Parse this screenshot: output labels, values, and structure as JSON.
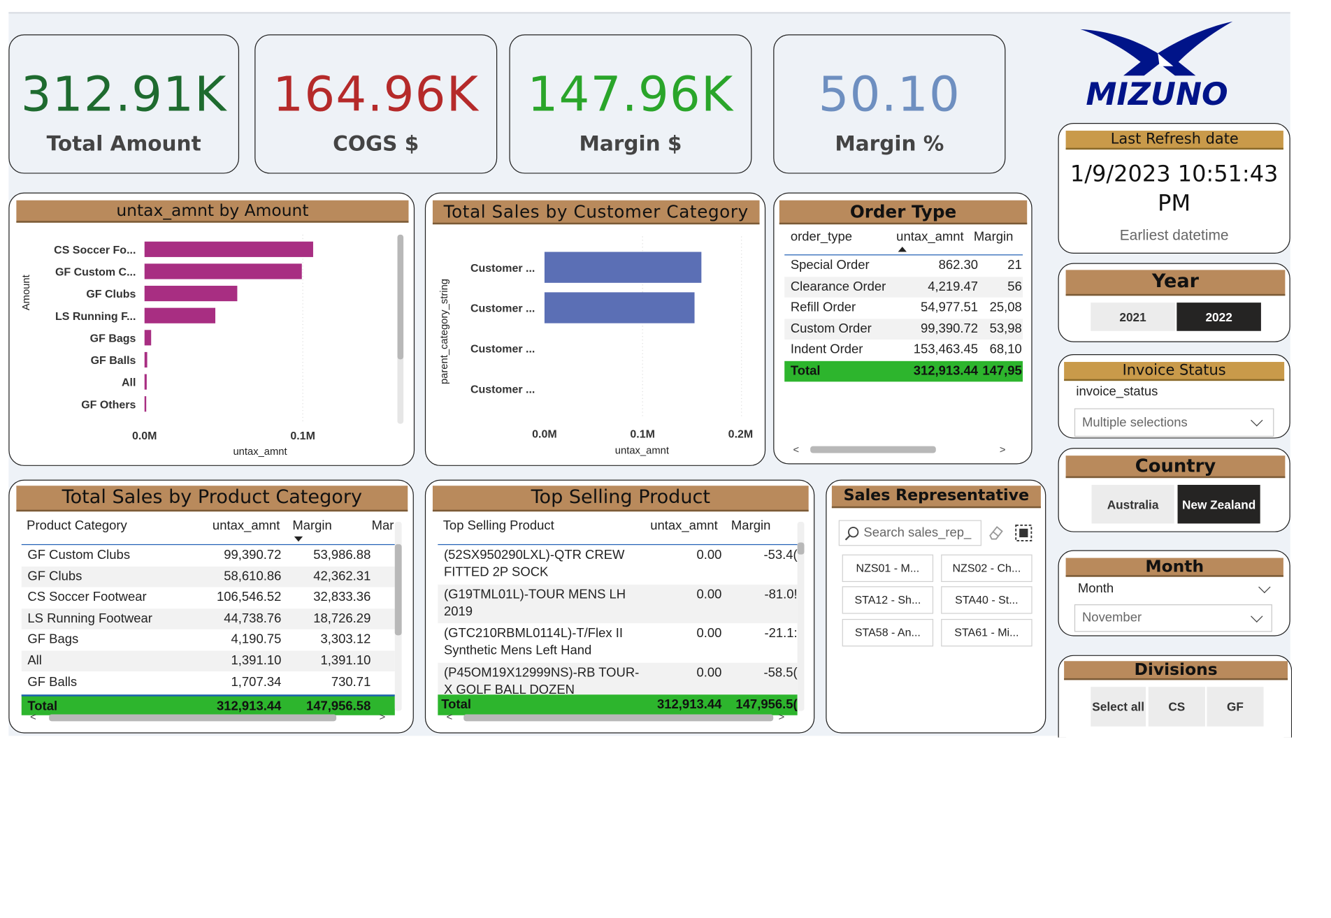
{
  "kpis": [
    {
      "value": "312.91K",
      "label": "Total Amount",
      "color": "#1e6b2f"
    },
    {
      "value": "164.96K",
      "label": "COGS $",
      "color": "#b52a2a"
    },
    {
      "value": "147.96K",
      "label": "Margin $",
      "color": "#2aa52a"
    },
    {
      "value": "50.10",
      "label": "Margin %",
      "color": "#6e8fc0"
    }
  ],
  "logo": {
    "text": "MIZUNO",
    "color": "#001489"
  },
  "refresh": {
    "title": "Last Refresh date",
    "line1": "1/9/2023 10:51:43",
    "line2": "PM",
    "subtitle": "Earliest datetime"
  },
  "year": {
    "title": "Year",
    "options": [
      "2021",
      "2022"
    ],
    "selected": "2022"
  },
  "invoice": {
    "title": "Invoice Status",
    "field": "invoice_status",
    "value": "Multiple selections"
  },
  "country": {
    "title": "Country",
    "options": [
      "Australia",
      "New Zealand"
    ],
    "selected": "New Zealand"
  },
  "month": {
    "title": "Month",
    "field": "Month",
    "value": "November"
  },
  "divisions": {
    "title": "Divisions",
    "options": [
      "Select all",
      "CS",
      "GF"
    ]
  },
  "amount_chart": {
    "header": "untax_amnt by Amount",
    "ylabel": "Amount",
    "xlabel": "untax_amnt",
    "x_ticks": [
      "0.0M",
      "0.1M"
    ]
  },
  "customer_chart": {
    "header": "Total Sales by Customer Category",
    "ylabel": "parent_category_string",
    "xlabel": "untax_amnt",
    "x_ticks": [
      "0.0M",
      "0.1M",
      "0.2M"
    ]
  },
  "chart_data": [
    {
      "type": "bar",
      "orientation": "horizontal",
      "title": "untax_amnt by Amount",
      "xlabel": "untax_amnt",
      "ylabel": "Amount",
      "categories": [
        "CS Soccer Fo...",
        "GF Custom C...",
        "GF Clubs",
        "LS Running F...",
        "GF Bags",
        "GF Balls",
        "All",
        "GF Others"
      ],
      "values": [
        106546.52,
        99390.72,
        58610.86,
        44738.76,
        4190.75,
        1707.34,
        1391.1,
        700
      ],
      "xlim": [
        0,
        0.16
      ],
      "x_unit": "M",
      "color": "#a82e82",
      "grid": true
    },
    {
      "type": "bar",
      "orientation": "horizontal",
      "title": "Total Sales by Customer Category",
      "xlabel": "untax_amnt",
      "ylabel": "parent_category_string",
      "categories": [
        "Customer ...",
        "Customer ...",
        "Customer ...",
        "Customer ..."
      ],
      "values": [
        160000,
        153000,
        0,
        0
      ],
      "xlim": [
        0,
        0.2
      ],
      "x_unit": "M",
      "color": "#5b6fb5",
      "grid": true
    }
  ],
  "order_type": {
    "header": "Order Type",
    "columns": [
      "order_type",
      "untax_amnt",
      "Margin"
    ],
    "rows": [
      [
        "Special Order",
        "862.30",
        "21"
      ],
      [
        "Clearance Order",
        "4,219.47",
        "56"
      ],
      [
        "Refill Order",
        "54,977.51",
        "25,08"
      ],
      [
        "Custom Order",
        "99,390.72",
        "53,98"
      ],
      [
        "Indent Order",
        "153,463.45",
        "68,10"
      ]
    ],
    "total": [
      "Total",
      "312,913.44",
      "147,95"
    ]
  },
  "product_category": {
    "header": "Total Sales by Product Category",
    "columns": [
      "Product Category",
      "untax_amnt",
      "Margin",
      "Mar"
    ],
    "rows": [
      [
        "GF Custom Clubs",
        "99,390.72",
        "53,986.88"
      ],
      [
        "GF Clubs",
        "58,610.86",
        "42,362.31"
      ],
      [
        "CS Soccer Footwear",
        "106,546.52",
        "32,833.36"
      ],
      [
        "LS Running Footwear",
        "44,738.76",
        "18,726.29"
      ],
      [
        "GF Bags",
        "4,190.75",
        "3,303.12"
      ],
      [
        "All",
        "1,391.10",
        "1,391.10"
      ],
      [
        "GF Balls",
        "1,707.34",
        "730.71"
      ]
    ],
    "total": [
      "Total",
      "312,913.44",
      "147,956.58"
    ]
  },
  "top_product": {
    "header": "Top Selling Product",
    "columns": [
      "Top Selling Product",
      "untax_amnt",
      "Margin"
    ],
    "rows": [
      [
        "(52SX950290LXL)-QTR CREW",
        "FITTED 2P SOCK",
        "0.00",
        "-53.4("
      ],
      [
        "(G19TML01L)-TOUR MENS LH",
        "2019",
        "0.00",
        "-81.0!"
      ],
      [
        "(GTC210RBML0114L)-T/Flex II",
        "Synthetic Mens Left Hand",
        "0.00",
        "-21.1:"
      ],
      [
        "(P45OM19X12999NS)-RB TOUR-",
        "X GOLF BALL DOZEN",
        "0.00",
        "-58.5("
      ]
    ],
    "total": [
      "Total",
      "312,913.44",
      "147,956.5("
    ]
  },
  "sales_rep": {
    "header": "Sales Representative",
    "search_placeholder": "Search sales_rep_",
    "chips": [
      "NZS01 - M...",
      "NZS02 - Ch...",
      "STA12 - Sh...",
      "STA40 - St...",
      "STA58 - An...",
      "STA61 - Mi..."
    ]
  },
  "colors": {
    "header_brown": "#b98a5c",
    "total_green": "#2db52d",
    "accent_blue": "#1f5fb5"
  }
}
